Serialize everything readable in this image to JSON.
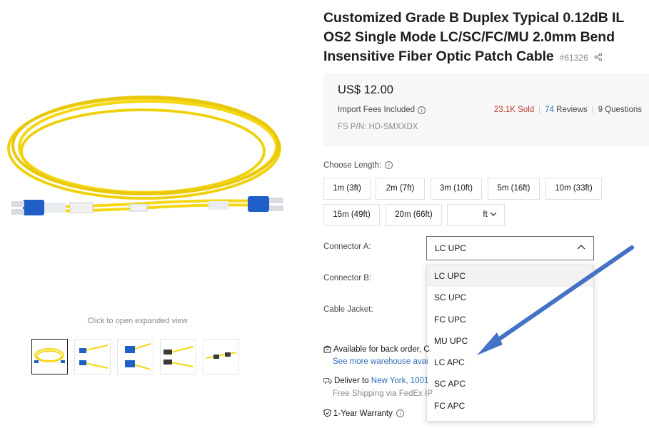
{
  "gallery": {
    "expand_hint": "Click to open expanded view",
    "thumbnails": [
      "duplex-cable-coil",
      "lc-lc-connectors",
      "lc-lc-closeup",
      "fc-fc-connectors",
      "mu-mu-connectors"
    ]
  },
  "product": {
    "title": "Customized Grade B Duplex Typical 0.12dB IL OS2 Single Mode LC/SC/FC/MU 2.0mm Bend Insensitive Fiber Optic Patch Cable",
    "id": "#61326"
  },
  "price_box": {
    "price": "US$ 12.00",
    "import_fees": "Import Fees Included",
    "sold": "23.1K Sold",
    "reviews_num": "74",
    "reviews_label": " Reviews",
    "questions": "9 Questions",
    "part_number": "FS P/N: HD-SMXXDX"
  },
  "length": {
    "label": "Choose Length:",
    "options": [
      "1m (3ft)",
      "2m (7ft)",
      "3m (10ft)",
      "5m (16ft)",
      "10m (33ft)",
      "15m (49ft)",
      "20m (66ft)"
    ],
    "custom_unit": "ft"
  },
  "connector_a": {
    "label": "Connector A:",
    "selected": "LC UPC",
    "options": [
      "LC UPC",
      "SC UPC",
      "FC UPC",
      "MU UPC",
      "LC APC",
      "SC APC",
      "FC APC"
    ]
  },
  "connector_b": {
    "label": "Connector B:"
  },
  "cable_jacket": {
    "label": "Cable Jacket:"
  },
  "stock": {
    "availability": "Available for back order, C",
    "warehouse_link": "See more warehouse avai"
  },
  "delivery": {
    "prefix": "Deliver to ",
    "location": "New York, 1001",
    "shipping": "Free Shipping via FedEx IP"
  },
  "warranty": {
    "label": "1-Year Warranty"
  },
  "colors": {
    "cable_yellow": "#f5d715",
    "connector_blue": "#1f5fc7",
    "annotation_arrow": "#4472c4",
    "link_blue": "#2e6db4",
    "sold_red": "#c0392b"
  }
}
